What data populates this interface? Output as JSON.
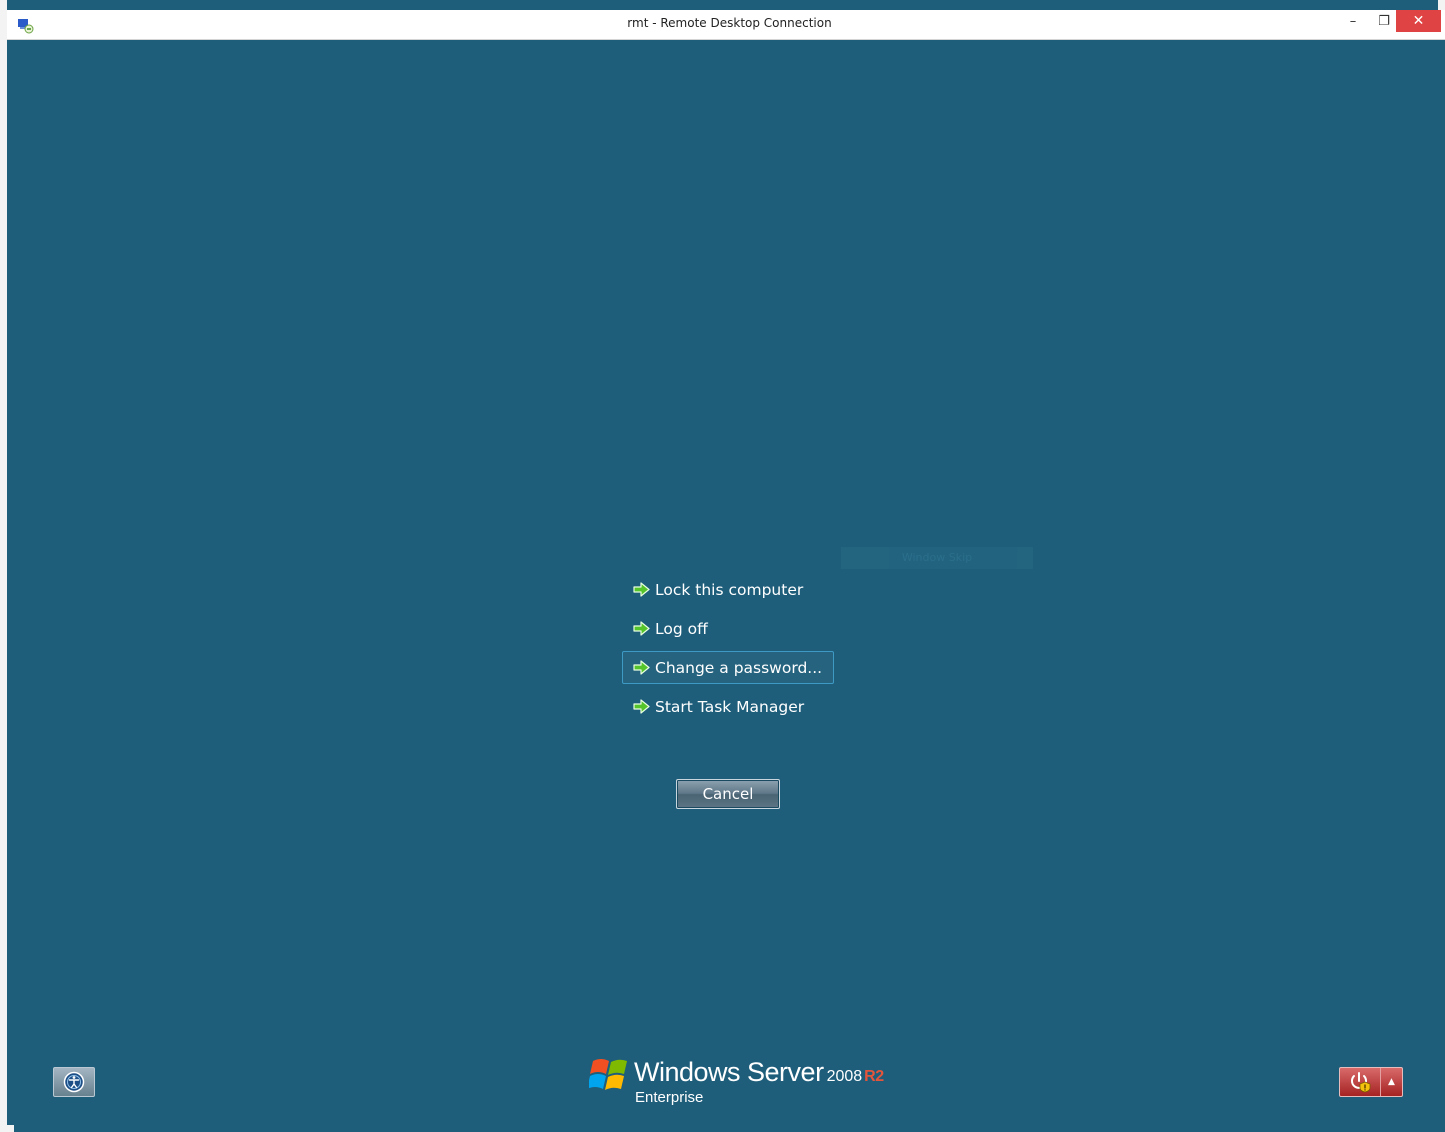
{
  "window": {
    "title": "rmt - Remote Desktop Connection",
    "controls": {
      "minimize": "–",
      "restore": "❐",
      "close": "✕"
    }
  },
  "background_banner": "Window Skip",
  "security_menu": {
    "items": [
      {
        "label": "Lock this computer",
        "icon": "green-arrow-icon"
      },
      {
        "label": "Log off",
        "icon": "green-arrow-icon"
      },
      {
        "label": "Change a password...",
        "icon": "green-arrow-icon",
        "focused": true
      },
      {
        "label": "Start Task Manager",
        "icon": "green-arrow-icon"
      }
    ],
    "cancel_label": "Cancel"
  },
  "branding": {
    "product": "Windows Server",
    "version": "2008",
    "release": "R2",
    "edition": "Enterprise"
  },
  "bottom_controls": {
    "ease_of_access_icon": "ease-of-access-icon",
    "power_icon": "shutdown-options-icon",
    "power_menu_arrow": "▲"
  },
  "colors": {
    "background": "#1e5e7b",
    "focus_border": "#3e9ac4",
    "power_button": "#b83030",
    "close_button": "#e04343",
    "r2_accent": "#e4553b"
  }
}
